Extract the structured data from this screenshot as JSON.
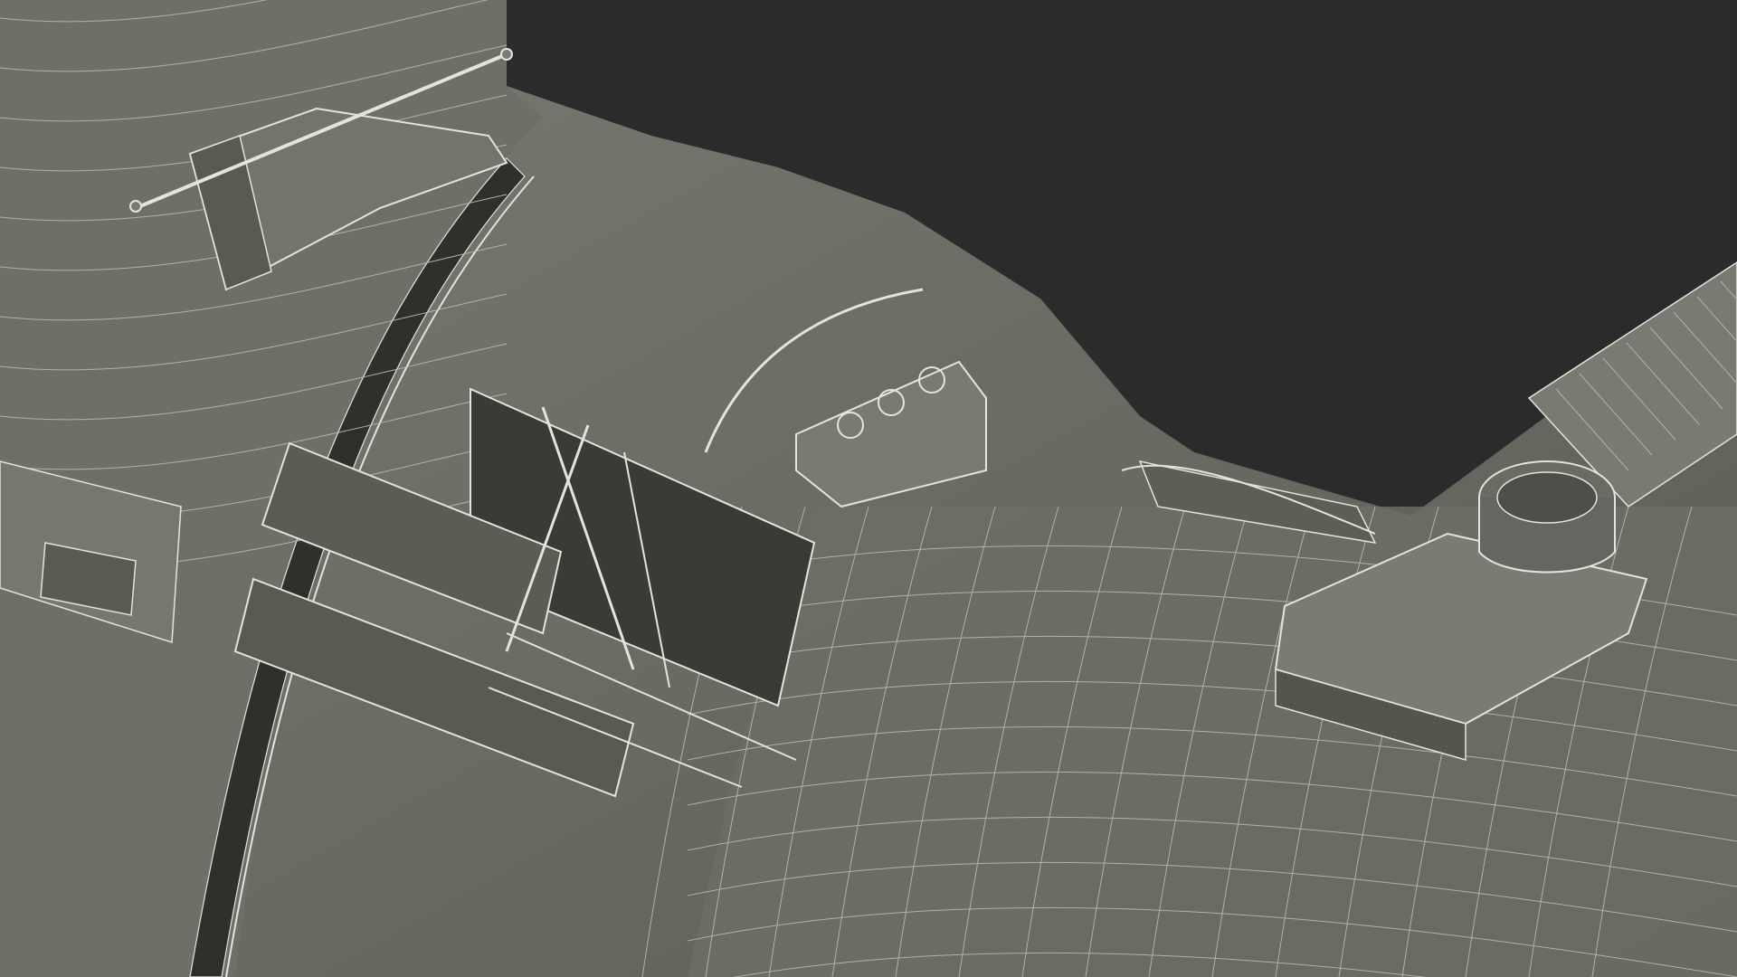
{
  "scene": {
    "subject": "wireframe-spacecraft-module",
    "colors": {
      "background": "#2b2b2b",
      "hull": "#6b6b63",
      "hull_light": "#7d7d75",
      "hull_dark": "#4c4c46",
      "shadow": "#33332f",
      "wire": "#e4e4dc",
      "wire_faint": "#b9b9b1"
    }
  }
}
